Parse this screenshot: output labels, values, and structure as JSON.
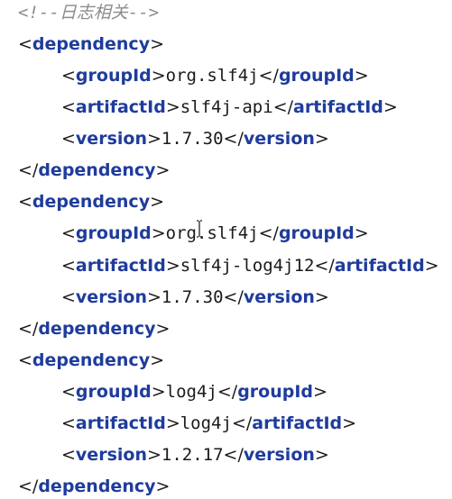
{
  "comment_line": "<!--日志相关-->",
  "blocks": [
    {
      "open_tag": "dependency",
      "group_id": "org.slf4j",
      "artifact_id": "slf4j-api",
      "version": "1.7.30"
    },
    {
      "open_tag": "dependency",
      "group_id": "org.slf4j",
      "artifact_id": "slf4j-log4j12",
      "version": "1.7.30"
    },
    {
      "open_tag": "dependency",
      "group_id": "log4j",
      "artifact_id": "log4j",
      "version": "1.2.17"
    }
  ],
  "tags": {
    "dependency": "dependency",
    "groupId": "groupId",
    "artifactId": "artifactId",
    "version": "version"
  },
  "syntax": {
    "lt": "<",
    "gt": ">",
    "lt_slash": "</"
  },
  "colors": {
    "tag": "#1f3c9c",
    "comment": "#8c8c8c",
    "text": "#1a1a1a",
    "background": "#ffffff"
  },
  "icons": {
    "text_cursor": "i-beam-cursor-icon"
  }
}
